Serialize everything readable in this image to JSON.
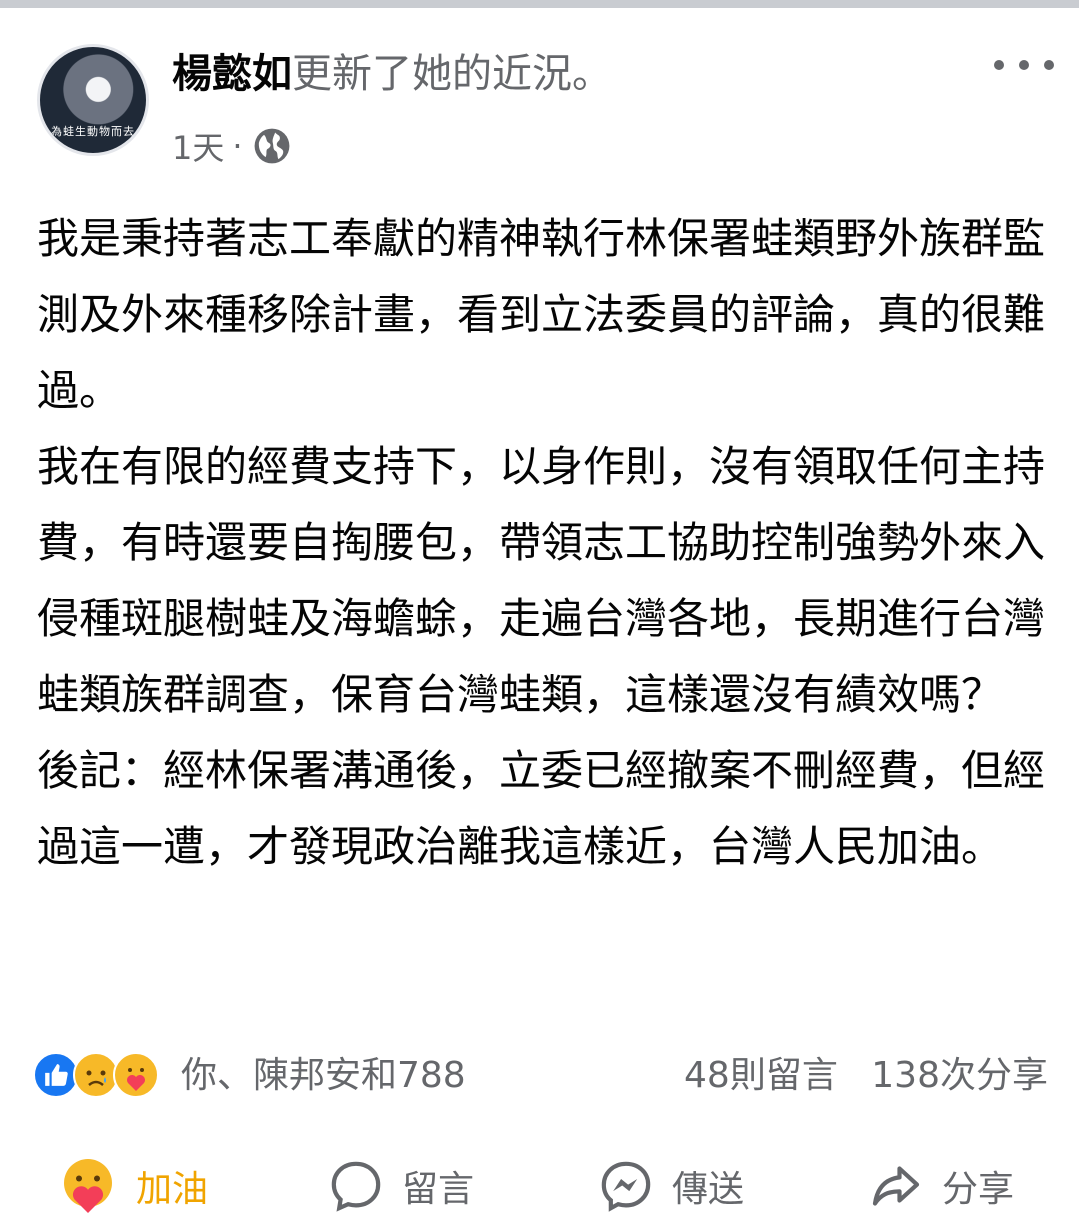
{
  "post": {
    "author": "楊懿如",
    "action": "更新了她的近況。",
    "time": "1天",
    "separator": "·",
    "avatar_badge_text": "為蛙生動物而去",
    "paragraphs": [
      "我是秉持著志工奉獻的精神執行林保署蛙類野外族群監測及外來種移除計畫，看到立法委員的評論，真的很難過。",
      "我在有限的經費支持下，以身作則，沒有領取任何主持費，有時還要自掏腰包，帶領志工協助控制強勢外來入侵種斑腿樹蛙及海蟾蜍，走遍台灣各地，長期進行台灣蛙類族群調查，保育台灣蛙類，這樣還沒有績效嗎？",
      "後記：經林保署溝通後，立委已經撤案不刪經費，但經過這一遭，才發現政治離我這樣近，台灣人民加油。"
    ]
  },
  "reactions": {
    "icons": [
      "like-icon",
      "sad-icon",
      "care-icon"
    ],
    "reacted_by": "你、陳邦安和788",
    "comments": "48則留言",
    "shares": "138次分享"
  },
  "actions": {
    "cheer": "加油",
    "comment": "留言",
    "send": "傳送",
    "share": "分享"
  },
  "colors": {
    "primary_text": "#050505",
    "secondary_text": "#65676b",
    "like_blue": "#1877f2",
    "care_yellow": "#f7b928",
    "cheer_label": "#f0a400"
  }
}
